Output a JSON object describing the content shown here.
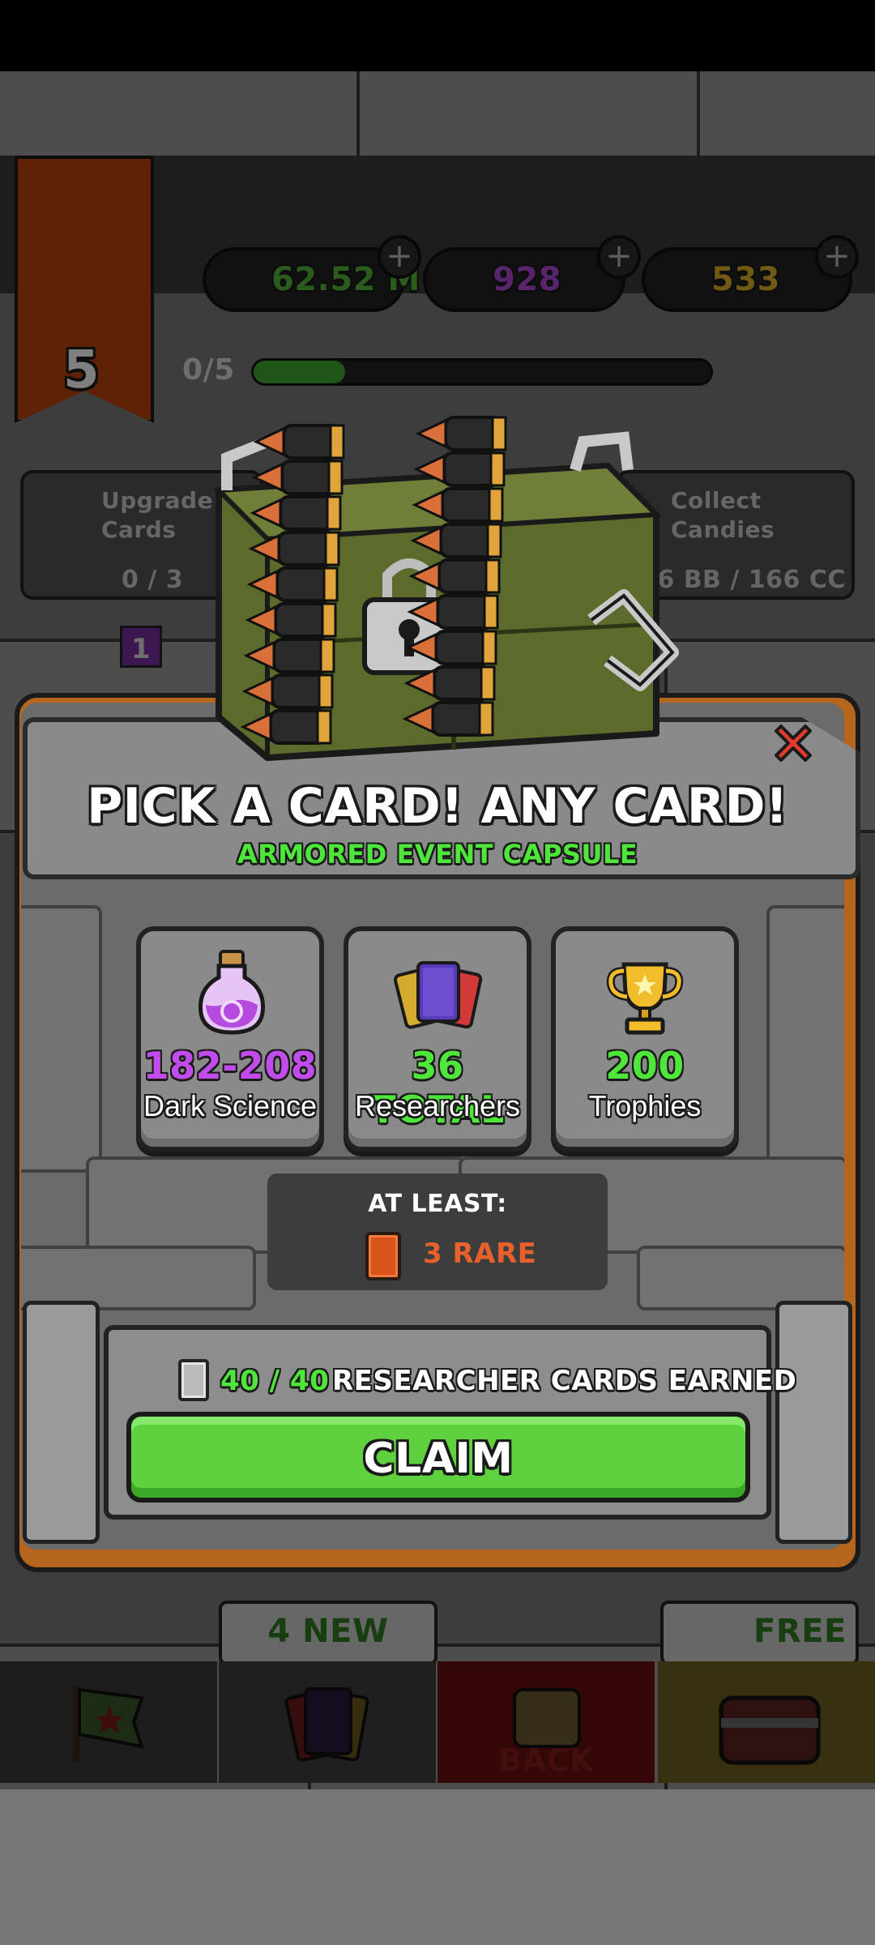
{
  "background": {
    "level": "5",
    "currencies": [
      {
        "name": "green-cash",
        "value": "62.52 M",
        "color": "#58b83a"
      },
      {
        "name": "dark-science",
        "value": "928",
        "color": "#b04ad8"
      },
      {
        "name": "gold",
        "value": "533",
        "color": "#e0b32a"
      }
    ],
    "progress_text": "0/5",
    "progress_fraction": 0.2,
    "quests": [
      {
        "label": "Upgrade Cards",
        "count": "0 / 3"
      },
      {
        "label": "Collect Candies",
        "count": "76 BB / 166 CC"
      }
    ],
    "quest_badge": "1",
    "nav": {
      "new_badge": "4 NEW",
      "back_label": "BACK",
      "free_badge": "FREE"
    }
  },
  "modal": {
    "title": "PICK A CARD! ANY CARD!",
    "subtitle": "ARMORED EVENT CAPSULE",
    "close_icon": "close-x-icon",
    "rewards": [
      {
        "value": "182-208",
        "label": "Dark Science",
        "value_color": "#c24bec",
        "icon": "potion-icon"
      },
      {
        "value": "36 TOTAL",
        "label": "Researchers",
        "value_color": "#4ee63a",
        "icon": "cards-icon"
      },
      {
        "value": "200",
        "label": "Trophies",
        "value_color": "#4ee63a",
        "icon": "trophy-icon"
      }
    ],
    "at_least_label": "AT LEAST:",
    "rare_text": "3 RARE",
    "researcher_progress": "40 / 40",
    "researcher_label": "RESEARCHER CARDS EARNED",
    "claim_label": "CLAIM"
  },
  "colors": {
    "green_accent": "#4ee63a",
    "purple_accent": "#c24bec",
    "rare_orange": "#e8612c",
    "claim_green": "#5fd13e",
    "frame_wood": "#b5651d"
  }
}
